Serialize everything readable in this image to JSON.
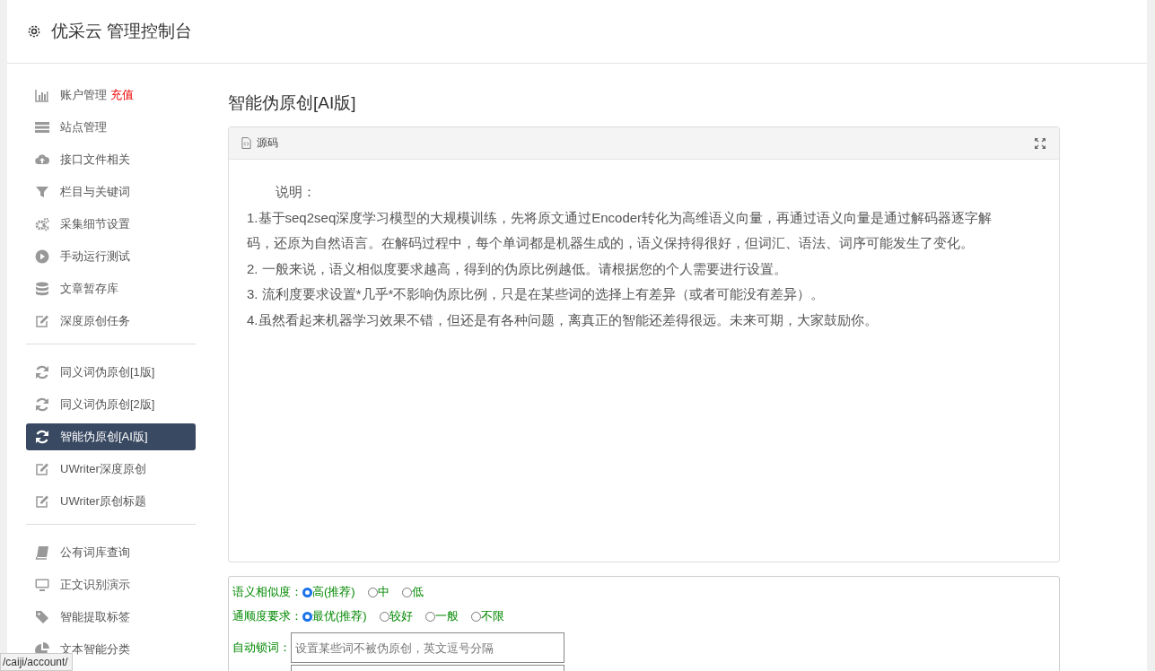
{
  "header": {
    "title": "优采云 管理控制台"
  },
  "sidebar": {
    "groups": [
      {
        "items": [
          {
            "label": "账户管理",
            "badge": "充值",
            "kind": "chart",
            "selected": false
          },
          {
            "label": "站点管理",
            "kind": "server",
            "selected": false
          },
          {
            "label": "接口文件相关",
            "kind": "cloud",
            "selected": false
          },
          {
            "label": "栏目与关键词",
            "kind": "filter",
            "selected": false
          },
          {
            "label": "采集细节设置",
            "kind": "gears",
            "selected": false
          },
          {
            "label": "手动运行测试",
            "kind": "play",
            "selected": false
          },
          {
            "label": "文章暂存库",
            "kind": "database",
            "selected": false
          },
          {
            "label": "深度原创任务",
            "kind": "edit",
            "selected": false
          }
        ]
      },
      {
        "items": [
          {
            "label": "同义词伪原创[1版]",
            "kind": "refresh",
            "selected": false
          },
          {
            "label": "同义词伪原创[2版]",
            "kind": "refresh",
            "selected": false
          },
          {
            "label": "智能伪原创[AI版]",
            "kind": "refresh",
            "selected": true
          },
          {
            "label": "UWriter深度原创",
            "kind": "edit",
            "selected": false
          },
          {
            "label": "UWriter原创标题",
            "kind": "edit",
            "selected": false
          }
        ]
      },
      {
        "items": [
          {
            "label": "公有词库查询",
            "kind": "book",
            "selected": false
          },
          {
            "label": "正文识别演示",
            "kind": "monitor",
            "selected": false
          },
          {
            "label": "智能提取标签",
            "kind": "tag",
            "selected": false
          },
          {
            "label": "文本智能分类",
            "kind": "pie",
            "selected": false
          }
        ]
      }
    ]
  },
  "page_title": "智能伪原创[AI版]",
  "editor": {
    "tab": "源码",
    "paragraphs": [
      "说明：",
      "1.基于seq2seq深度学习模型的大规模训练，先将原文通过Encoder转化为高维语义向量，再通过语义向量是通过解码器逐字解码，还原为自然语言。在解码过程中，每个单词都是机器生成的，语义保持得很好，但词汇、语法、词序可能发生了变化。",
      "2. 一般来说，语义相似度要求越高，得到的伪原比例越低。请根据您的个人需要进行设置。",
      "3. 流利度要求设置*几乎*不影响伪原比例，只是在某些词的选择上有差异（或者可能没有差异）。",
      "4.虽然看起来机器学习效果不错，但还是有各种问题，离真正的智能还差得很远。未来可期，大家鼓励你。"
    ]
  },
  "form": {
    "options": [
      {
        "label": "语义相似度：",
        "choices": [
          {
            "label": "高(推荐)",
            "selected": true
          },
          {
            "label": "中",
            "selected": false
          },
          {
            "label": "低",
            "selected": false
          }
        ]
      },
      {
        "label": "通顺度要求：",
        "choices": [
          {
            "label": "最优(推荐)",
            "selected": true
          },
          {
            "label": "较好",
            "selected": false
          },
          {
            "label": "一般",
            "selected": false
          },
          {
            "label": "不限",
            "selected": false
          }
        ]
      }
    ],
    "lock": {
      "label": "自动锁词：",
      "placeholder": "设置某些词不被伪原创，英文逗号分隔"
    }
  },
  "status_bar": {
    "url": "/caiji/account/"
  }
}
